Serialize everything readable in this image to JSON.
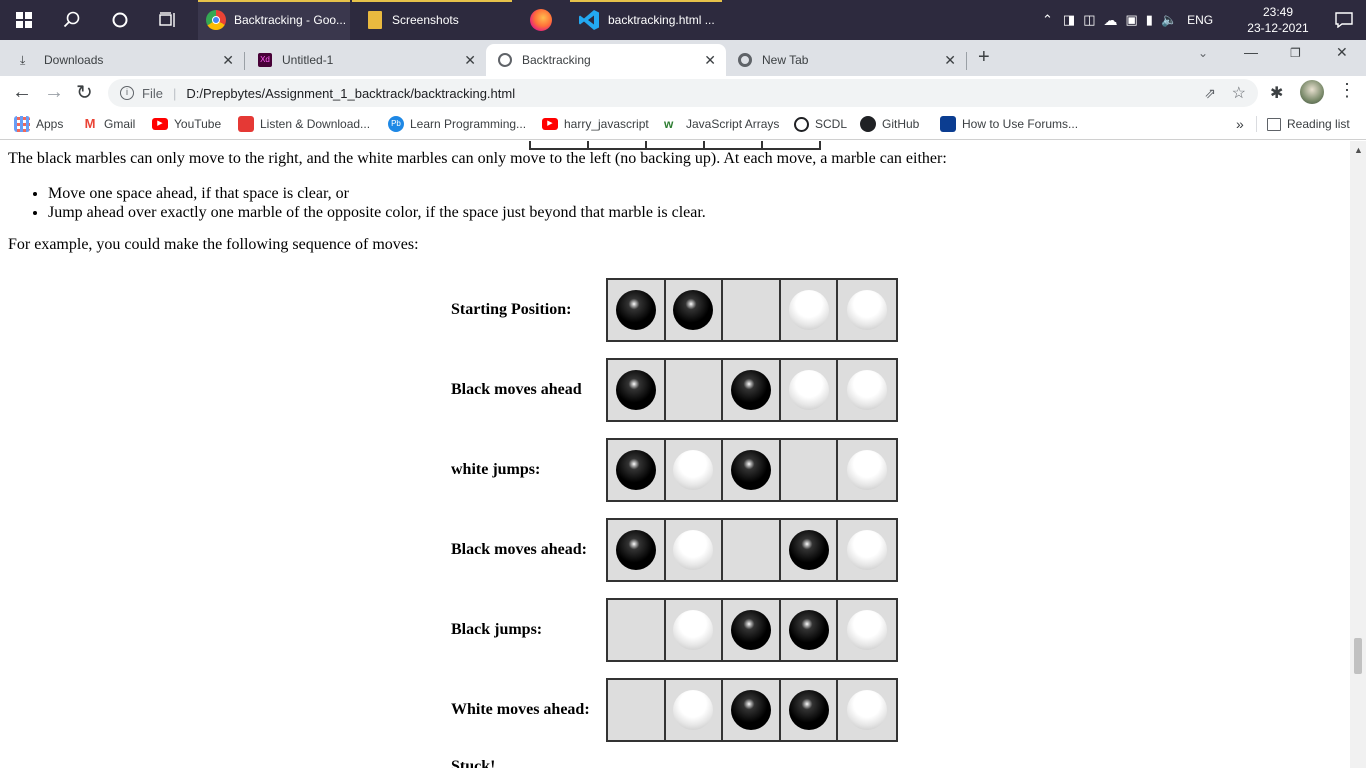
{
  "taskbar": {
    "apps": [
      {
        "label": "Backtracking - Goo...",
        "icon": "chrome-icon"
      },
      {
        "label": "Screenshots",
        "icon": "folder-icon"
      },
      {
        "label": "",
        "icon": "firefox-icon"
      },
      {
        "label": "backtracking.html ...",
        "icon": "vscode-icon"
      }
    ],
    "language": "ENG",
    "time": "23:49",
    "date": "23-12-2021"
  },
  "browser": {
    "tabs": [
      {
        "label": "Downloads",
        "icon": "download-icon"
      },
      {
        "label": "Untitled-1",
        "icon": "xd-icon"
      },
      {
        "label": "Backtracking",
        "icon": "globe-icon"
      },
      {
        "label": "New Tab",
        "icon": "chrome-icon"
      }
    ],
    "address_scheme": "File",
    "address_url": "D:/Prepbytes/Assignment_1_backtrack/backtracking.html",
    "bookmarks": [
      {
        "label": "Apps",
        "color": "#4285f4"
      },
      {
        "label": "Gmail",
        "color": "#ea4335"
      },
      {
        "label": "YouTube",
        "color": "#ff0000"
      },
      {
        "label": "Listen & Download...",
        "color": "#e53935"
      },
      {
        "label": "Learn Programming...",
        "color": "#1e88e5"
      },
      {
        "label": "harry_javascript",
        "color": "#ff0000"
      },
      {
        "label": "JavaScript Arrays",
        "color": "#2e7d32"
      },
      {
        "label": "SCDL",
        "color": "#202124"
      },
      {
        "label": "GitHub",
        "color": "#202124"
      },
      {
        "label": "How to Use Forums...",
        "color": "#0b3d91"
      }
    ],
    "more_bookmarks": "»",
    "reading_list": "Reading list"
  },
  "page": {
    "intro": "The black marbles can only move to the right, and the white marbles can only move to the left (no backing up). At each move, a marble can either:",
    "rules": [
      "Move one space ahead, if that space is clear, or",
      "Jump ahead over exactly one marble of the opposite color, if the space just beyond that marble is clear."
    ],
    "example_intro": "For example, you could make the following sequence of moves:",
    "boards": [
      {
        "label": "Starting Position:",
        "cells": [
          "black",
          "black",
          "empty",
          "white",
          "white"
        ]
      },
      {
        "label": "Black moves ahead",
        "cells": [
          "black",
          "empty",
          "black",
          "white",
          "white"
        ]
      },
      {
        "label": "white jumps:",
        "cells": [
          "black",
          "white",
          "black",
          "empty",
          "white"
        ]
      },
      {
        "label": "Black moves ahead:",
        "cells": [
          "black",
          "white",
          "empty",
          "black",
          "white"
        ]
      },
      {
        "label": "Black jumps:",
        "cells": [
          "empty",
          "white",
          "black",
          "black",
          "white"
        ]
      },
      {
        "label": "White moves ahead:",
        "cells": [
          "empty",
          "white",
          "black",
          "black",
          "white"
        ]
      }
    ],
    "final_label": "Stuck!"
  }
}
